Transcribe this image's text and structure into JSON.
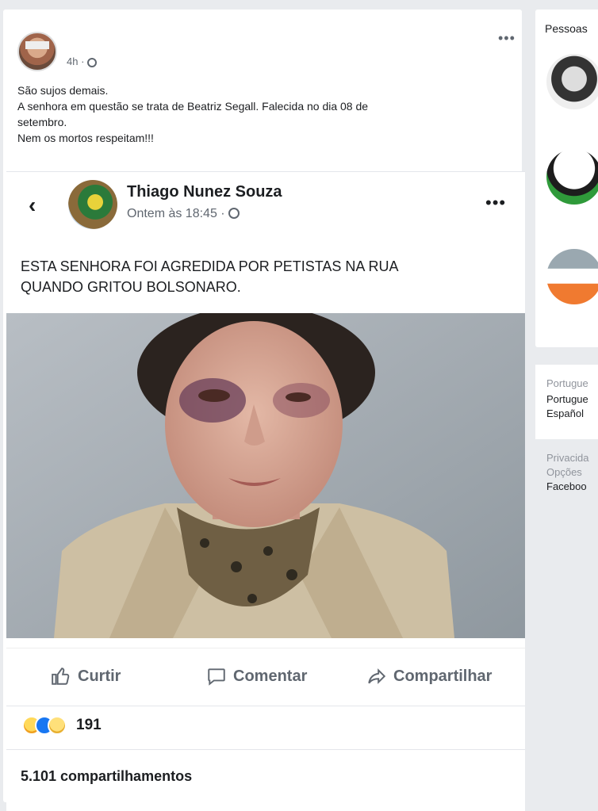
{
  "outer_post": {
    "author_name": "",
    "time": "4h ·",
    "menu": "•••",
    "text_lines": [
      "São sujos demais.",
      "A senhora em questão se trata de Beatriz Segall. Falecida no dia 08 de",
      "setembro.",
      "Nem os mortos respeitam!!!"
    ]
  },
  "shared_post": {
    "back": "‹",
    "author": "Thiago Nunez Souza",
    "time": "Ontem às 18:45 ·",
    "menu": "•••",
    "text_lines": [
      "ESTA SENHORA FOI AGREDIDA POR PETISTAS NA RUA",
      "QUANDO GRITOU BOLSONARO."
    ]
  },
  "actions": {
    "like": "Curtir",
    "comment": "Comentar",
    "share": "Compartilhar"
  },
  "reactions": {
    "count": "191",
    "icons": [
      "haha-icon",
      "like-icon",
      "sad-icon"
    ]
  },
  "shares": "5.101 compartilhamentos",
  "right_panel": {
    "people_title": "Pessoas",
    "lang_lines": [
      "Portugue",
      "Portugue",
      "Español"
    ],
    "footer_lines": [
      "Privacida",
      "Opções",
      "Faceboo"
    ]
  },
  "colors": {
    "page_bg": "#e9ebee",
    "card_bg": "#ffffff",
    "muted_text": "#606770"
  }
}
